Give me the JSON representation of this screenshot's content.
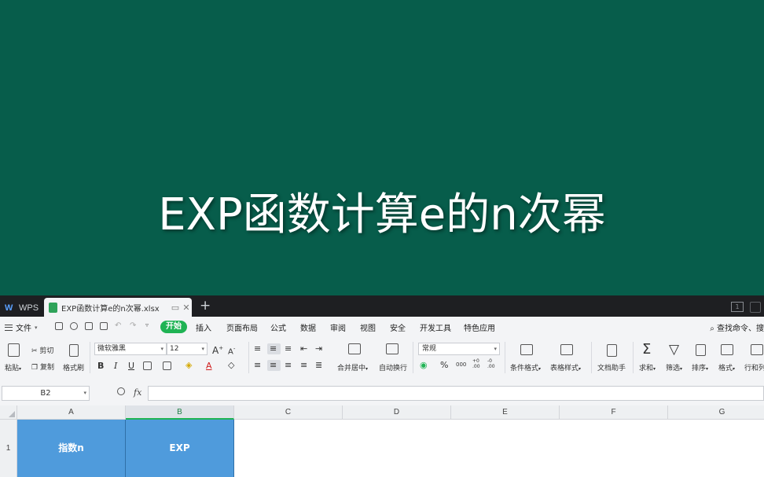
{
  "banner": {
    "title": "EXP函数计算e的n次幂",
    "background": "#075d4b"
  },
  "tabbar": {
    "app_label": "WPS",
    "doc_tab": "EXP函数计算e的n次幂.xlsx",
    "close_glyph": "✕",
    "restore_glyph": "▭",
    "new_tab_glyph": "+",
    "page_indicator": "1"
  },
  "menubar": {
    "file": "文件",
    "tabs": [
      "开始",
      "插入",
      "页面布局",
      "公式",
      "数据",
      "审阅",
      "视图",
      "安全",
      "开发工具",
      "特色应用"
    ],
    "search": "查找命令、搜"
  },
  "ribbon": {
    "paste": "粘贴",
    "cut": "剪切",
    "copy": "复制",
    "format_painter": "格式刷",
    "font_name": "微软雅黑",
    "font_size": "12",
    "grow_font": "A",
    "shrink_font": "A",
    "bold": "B",
    "italic": "I",
    "underline": "U",
    "merge_center": "合并居中",
    "wrap_text": "自动换行",
    "number_format": "常规",
    "percent": "%",
    "thousands": "000",
    "inc_decimal": "+0 .00",
    "dec_decimal": "-0 .00",
    "conditional_format": "条件格式",
    "table_style": "表格样式",
    "doc_helper": "文档助手",
    "sum": "求和",
    "filter": "筛选",
    "sort": "排序",
    "format": "格式",
    "rows_cols": "行和列",
    "accent": "#1fb354"
  },
  "formula_bar": {
    "cell_ref": "B2",
    "fx": "fx",
    "value": ""
  },
  "grid": {
    "columns": [
      "A",
      "B",
      "C",
      "D",
      "E",
      "F",
      "G"
    ],
    "rows": [
      "1"
    ],
    "cells": {
      "A1": "指数n",
      "B1": "EXP"
    },
    "header_fill": "#4f9bdc",
    "selected_column": "B"
  }
}
